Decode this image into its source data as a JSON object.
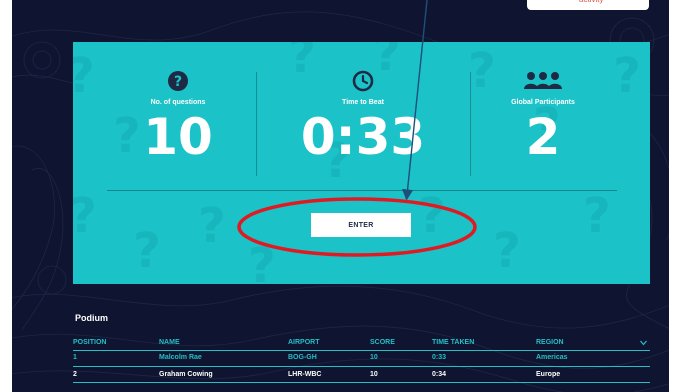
{
  "top_chip": {
    "text": "activity"
  },
  "stats": [
    {
      "icon": "question-icon",
      "label": "No. of questions",
      "value": "10"
    },
    {
      "icon": "clock-icon",
      "label": "Time to Beat",
      "value": "0:33"
    },
    {
      "icon": "participants-icon",
      "label": "Global Participants",
      "value": "2"
    }
  ],
  "enter_button": {
    "label": "ENTER"
  },
  "podium": {
    "title": "Podium",
    "columns": {
      "position": "POSITION",
      "name": "NAME",
      "airport": "AIRPORT",
      "score": "SCORE",
      "time_taken": "TIME TAKEN",
      "region": "REGION"
    },
    "rows": [
      {
        "position": "1",
        "name": "Malcolm Rae",
        "airport": "BOG-GH",
        "score": "10",
        "time_taken": "0:33",
        "region": "Americas"
      },
      {
        "position": "2",
        "name": "Graham Cowing",
        "airport": "LHR-WBC",
        "score": "10",
        "time_taken": "0:34",
        "region": "Europe"
      }
    ]
  },
  "colors": {
    "background": "#0f1530",
    "card": "#1bc2c8",
    "accent": "#26bfc6",
    "annotation": "#e01a22",
    "arrow": "#1d4f7a"
  }
}
